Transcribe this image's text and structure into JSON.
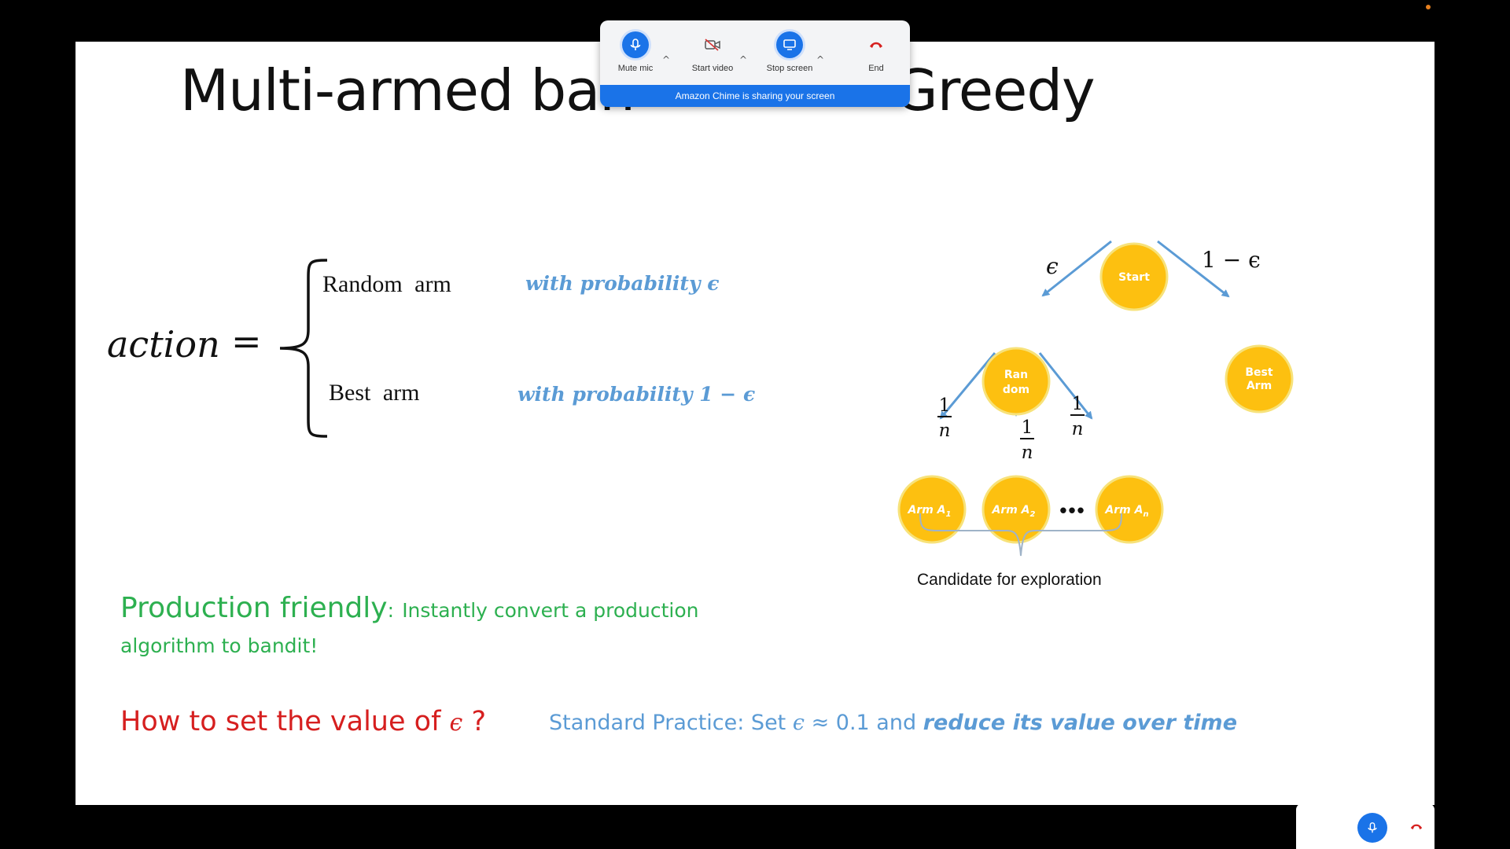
{
  "slide": {
    "title_left": "Multi-armed ban",
    "title_right": "Greedy",
    "equation": {
      "lhs": "action",
      "equals": "=",
      "case1_label": "Random  arm",
      "case1_prob": "with probability ϵ",
      "case2_label": "Best  arm",
      "case2_prob": "with probability 1 −  ϵ"
    },
    "tree": {
      "start": "Start",
      "random_line1": "Ran",
      "random_line2": "dom",
      "best_line1": "Best",
      "best_line2": "Arm",
      "arm1": "Arm A",
      "arm1_sub": "1",
      "arm2": "Arm A",
      "arm2_sub": "2",
      "armn": "Arm A",
      "armn_sub": "n",
      "edge_eps": "ϵ",
      "edge_one_minus_eps": "1 − ϵ",
      "frac_num": "1",
      "frac_den": "n",
      "ellipsis": "•••",
      "candidate_label": "Candidate for exploration"
    },
    "production": {
      "heading": "Production friendly",
      "colon": ":",
      "text_line1": "Instantly convert a production",
      "text_line2": "algorithm to bandit!"
    },
    "howto": {
      "text": "How to set the value of ",
      "eps": "ϵ",
      "q": " ?"
    },
    "standard": {
      "prefix": "Standard Practice: Set ",
      "eps": "ϵ",
      "approx": " ≈ 0.1 and ",
      "emphasis": "reduce its value over time"
    }
  },
  "chime": {
    "mute_label": "Mute mic",
    "video_label": "Start video",
    "stop_label": "Stop screen",
    "end_label": "End",
    "caret": "^",
    "banner": "Amazon Chime is sharing your screen"
  },
  "colors": {
    "node_fill": "#fdc010",
    "node_stroke": "#f7e27a",
    "arrow": "#5b9bd5",
    "green": "#2db050",
    "red": "#d61f1f",
    "blue": "#5b9bd5",
    "chime_blue": "#1a73e8"
  }
}
